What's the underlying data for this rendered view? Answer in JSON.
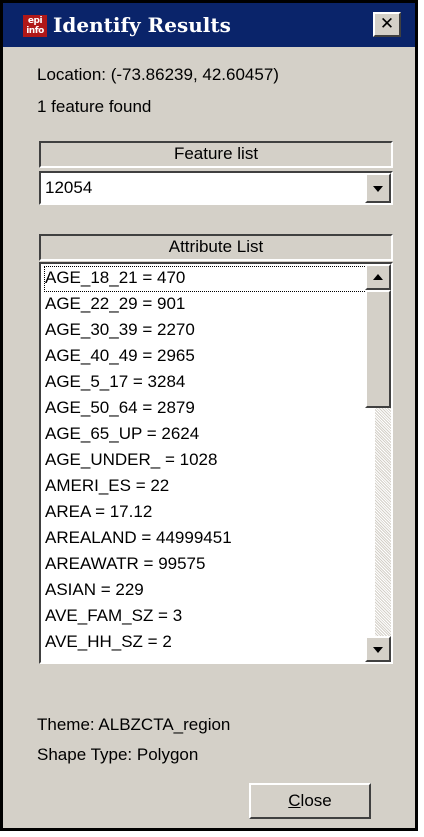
{
  "window": {
    "title": "Identify Results",
    "logo_text_top": "epi",
    "logo_text_bottom": "info",
    "logo_icon": "epi-info-logo-icon",
    "close_icon": "close-x-icon",
    "close_glyph": "✕"
  },
  "info": {
    "location": "Location: (-73.86239, 42.60457)",
    "count": "1 feature found"
  },
  "feature_list": {
    "header": "Feature list",
    "selected_value": "12054",
    "dropdown_icon": "chevron-down-icon"
  },
  "attribute_list": {
    "header": "Attribute List",
    "items": [
      "AGE_18_21 = 470",
      "AGE_22_29 = 901",
      "AGE_30_39 = 2270",
      "AGE_40_49 = 2965",
      "AGE_5_17 = 3284",
      "AGE_50_64 = 2879",
      "AGE_65_UP = 2624",
      "AGE_UNDER_ = 1028",
      "AMERI_ES = 22",
      "AREA = 17.12",
      "AREALAND = 44999451",
      "AREAWATR = 99575",
      "ASIAN = 229",
      "AVE_FAM_SZ = 3",
      "AVE_HH_SZ = 2"
    ],
    "scroll_up_icon": "scroll-up-icon",
    "scroll_down_icon": "scroll-down-icon"
  },
  "footer": {
    "theme": "Theme: ALBZCTA_region",
    "shape_type": "Shape Type: Polygon"
  },
  "close_button": {
    "mnemonic": "C",
    "rest": "lose"
  },
  "colors": {
    "titlebar": "#0a246a",
    "window_face": "#d4d0c8",
    "logo_red": "#b01818"
  }
}
